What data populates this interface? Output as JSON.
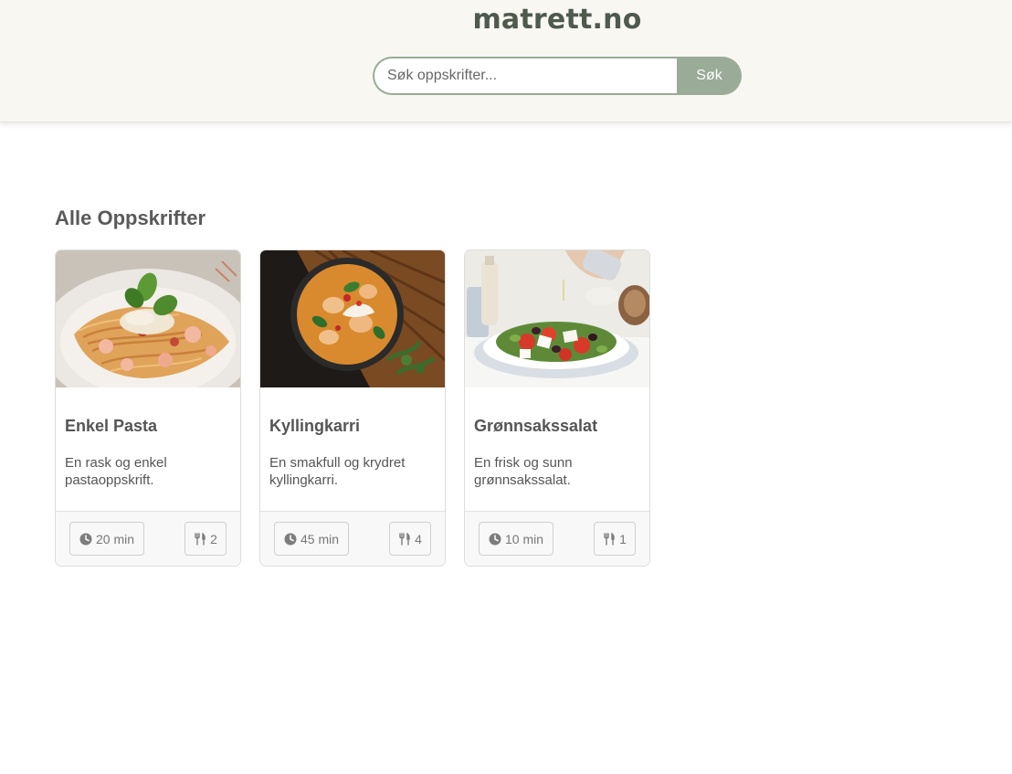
{
  "header": {
    "site_title": "matrett.no",
    "search": {
      "placeholder": "Søk oppskrifter...",
      "value": "",
      "button_label": "Søk"
    }
  },
  "main": {
    "section_title": "Alle Oppskrifter",
    "recipes": [
      {
        "title": "Enkel Pasta",
        "description": "En rask og enkel pastaoppskrift.",
        "time": "20 min",
        "servings": "2",
        "time_icon": "clock-icon",
        "servings_icon": "utensils-icon"
      },
      {
        "title": "Kyllingkarri",
        "description": "En smakfull og krydret kyllingkarri.",
        "time": "45 min",
        "servings": "4",
        "time_icon": "clock-icon",
        "servings_icon": "utensils-icon"
      },
      {
        "title": "Grønnsakssalat",
        "description": "En frisk og sunn grønnsakssalat.",
        "time": "10 min",
        "servings": "1",
        "time_icon": "clock-icon",
        "servings_icon": "utensils-icon"
      }
    ]
  },
  "colors": {
    "header_bg": "#f8f7f2",
    "accent": "#9aab97",
    "title": "#4e5a4c",
    "text": "#555555"
  }
}
